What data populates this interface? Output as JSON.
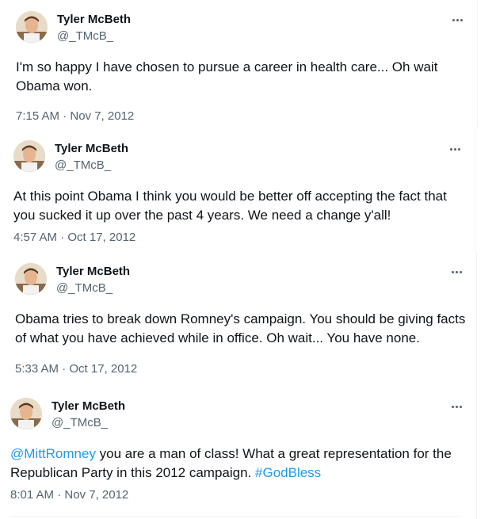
{
  "tweets": [
    {
      "name": "Tyler McBeth",
      "handle": "@_TMcB_",
      "text": "I'm so happy I have chosen to pursue a career in health care... Oh wait Obama won.",
      "time": "7:15 AM · Nov 7, 2012"
    },
    {
      "name": "Tyler McBeth",
      "handle": "@_TMcB_",
      "text": "At this point Obama I think you would be better off accepting the fact that you sucked it up over the past 4 years. We need a change y'all!",
      "time": "4:57 AM · Oct 17, 2012"
    },
    {
      "name": "Tyler McBeth",
      "handle": "@_TMcB_",
      "text": "Obama tries to break down Romney's campaign. You should be giving facts of what you have achieved while in office. Oh wait... You have none.",
      "time": "5:33 AM · Oct 17, 2012"
    },
    {
      "name": "Tyler McBeth",
      "handle": "@_TMcB_",
      "mention": "@MittRomney",
      "text": " you are a man of class! What a great representation for the Republican Party in this 2012 campaign. ",
      "hashtag": "#GodBless",
      "time": "8:01 AM · Nov 7, 2012"
    }
  ],
  "icons": {
    "more": "more-horizontal-icon",
    "avatar": "profile-photo"
  },
  "colors": {
    "text": "#0f1419",
    "secondary": "#536471",
    "link": "#1d9bf0",
    "border": "#eff3f4"
  }
}
